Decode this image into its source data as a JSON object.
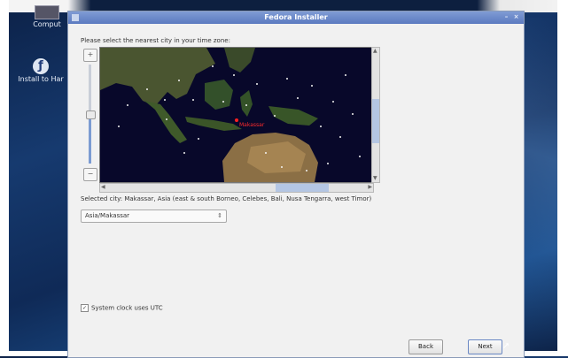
{
  "desktop": {
    "icons": [
      {
        "label": "Comput",
        "glyph": "🖥"
      },
      {
        "label": "Install to Har",
        "glyph": "ƒ"
      }
    ]
  },
  "window": {
    "title": "Fedora Installer",
    "controls": {
      "minimize": "–",
      "close": "×"
    }
  },
  "timezone": {
    "prompt": "Please select the nearest city in your time zone:",
    "zoom_in": "+",
    "zoom_out": "−",
    "map": {
      "selected_city_marker_label": "Makassar"
    },
    "selected_city_text": "Selected city: Makassar, Asia (east & south Borneo, Celebes, Bali, Nusa Tengarra, west Timor)",
    "timezone_select": {
      "value": "Asia/Makassar",
      "arrows": "⇕"
    },
    "utc_checkbox": {
      "label": "System clock uses UTC",
      "checked": true,
      "mark": "✓"
    }
  },
  "buttons": {
    "back": "Back",
    "next": "Next"
  },
  "colors": {
    "title_bar": "#6f8bcf",
    "marker": "#ff2020",
    "ocean": "#08082a"
  }
}
